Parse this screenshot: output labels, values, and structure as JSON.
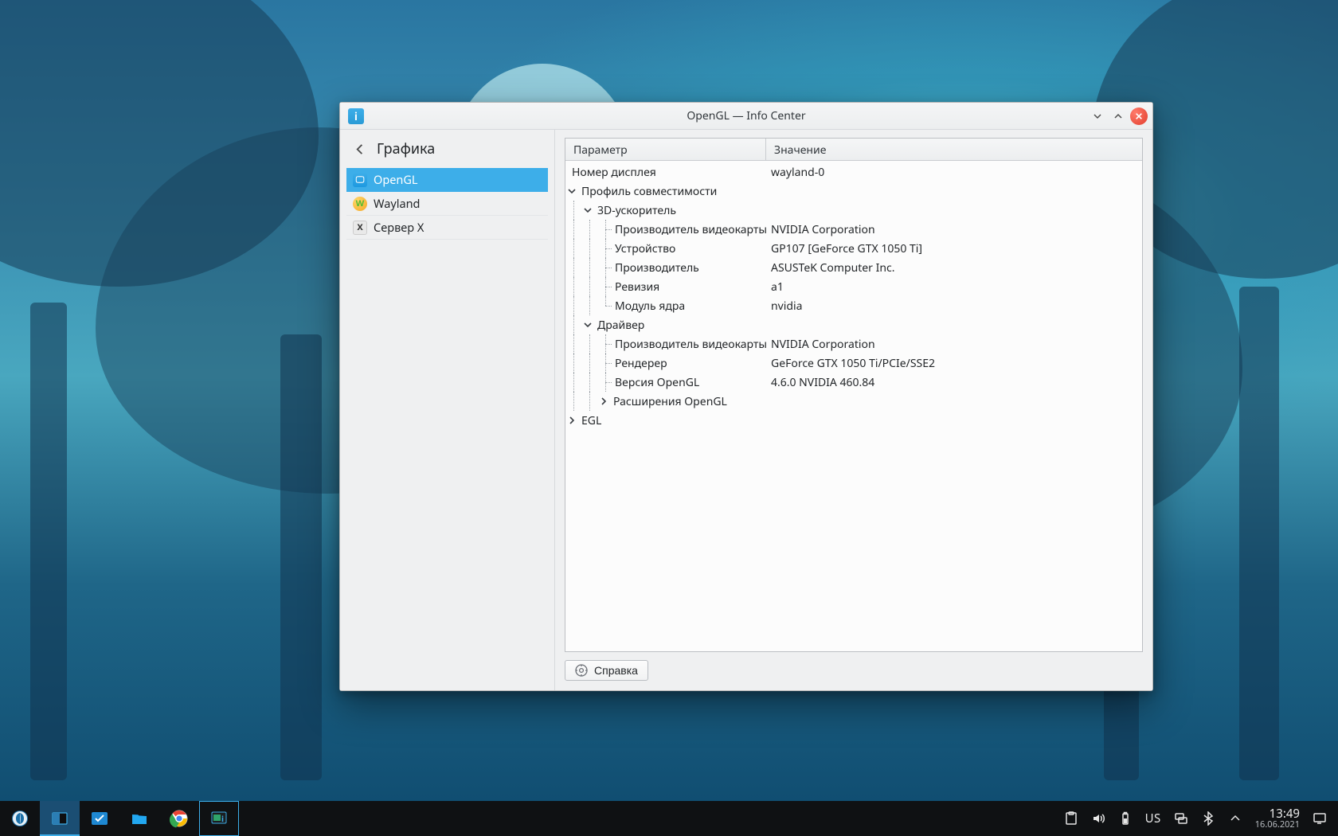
{
  "window": {
    "title": "OpenGL — Info Center"
  },
  "sidebar": {
    "section_title": "Графика",
    "items": [
      {
        "label": "OpenGL",
        "selected": true
      },
      {
        "label": "Wayland",
        "selected": false
      },
      {
        "label": "Сервер X",
        "selected": false
      }
    ]
  },
  "columns": {
    "param": "Параметр",
    "value": "Значение"
  },
  "tree": {
    "display_number": {
      "k": "Номер дисплея",
      "v": "wayland-0"
    },
    "compat_profile": "Профиль совместимости",
    "accel_3d": "3D-ускоритель",
    "accel": {
      "card_vendor": {
        "k": "Производитель видеокарты",
        "v": "NVIDIA Corporation"
      },
      "device": {
        "k": "Устройство",
        "v": "GP107 [GeForce GTX 1050 Ti]"
      },
      "vendor": {
        "k": "Производитель",
        "v": "ASUSTeK Computer Inc."
      },
      "revision": {
        "k": "Ревизия",
        "v": "a1"
      },
      "kernel_module": {
        "k": "Модуль ядра",
        "v": "nvidia"
      }
    },
    "driver": "Драйвер",
    "drv": {
      "card_vendor": {
        "k": "Производитель видеокарты",
        "v": "NVIDIA Corporation"
      },
      "renderer": {
        "k": "Рендерер",
        "v": "GeForce GTX 1050 Ti/PCIe/SSE2"
      },
      "gl_version": {
        "k": "Версия OpenGL",
        "v": "4.6.0 NVIDIA 460.84"
      },
      "gl_ext": {
        "k": "Расширения OpenGL"
      }
    },
    "egl": "EGL"
  },
  "buttons": {
    "help": "Справка"
  },
  "tray": {
    "keyboard_layout": "US",
    "time": "13:49",
    "date": "16.06.2021"
  }
}
